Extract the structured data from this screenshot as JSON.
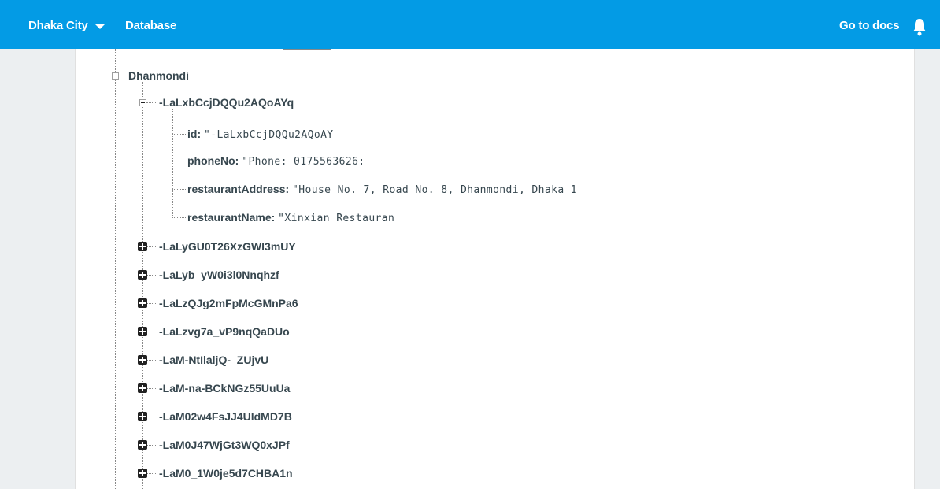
{
  "topbar": {
    "project": "Dhaka City",
    "section": "Database",
    "docs_link": "Go to docs",
    "background": "#039be5"
  },
  "tree": {
    "area": "Dhanmondi",
    "expanded": {
      "key": "-LaLxbCcjDQQu2AQoAYq",
      "fields": [
        {
          "name": "id:",
          "value": "\"-LaLxbCcjDQQu2AQoAY"
        },
        {
          "name": "phoneNo:",
          "value": "\"Phone: 0175563626:"
        },
        {
          "name": "restaurantAddress:",
          "value": "\"House No. 7, Road No. 8, Dhanmondi, Dhaka 1"
        },
        {
          "name": "restaurantName:",
          "value": "\"Xinxian Restauran "
        }
      ]
    },
    "collapsed": [
      "-LaLyGU0T26XzGWl3mUY",
      "-LaLyb_yW0i3l0Nnqhzf",
      "-LaLzQJg2mFpMcGMnPa6",
      "-LaLzvg7a_vP9nqQaDUo",
      "-LaM-NtIlaljQ-_ZUjvU",
      "-LaM-na-BCkNGz55UuUa",
      "-LaM02w4FsJJ4UldMD7B",
      "-LaM0J47WjGt3WQ0xJPf",
      "-LaM0_1W0je5d7CHBA1n"
    ]
  }
}
